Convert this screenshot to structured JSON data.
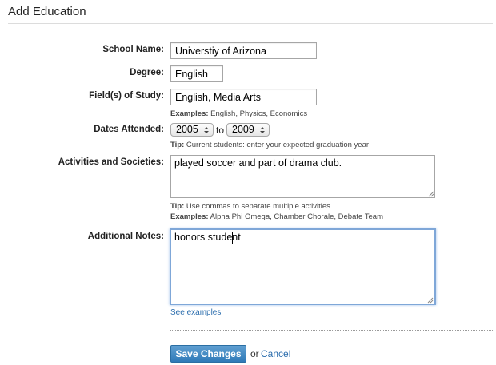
{
  "page": {
    "title": "Add Education"
  },
  "form": {
    "school_name": {
      "label": "School Name:",
      "value": "Universtiy of Arizona"
    },
    "degree": {
      "label": "Degree:",
      "value": "English"
    },
    "field_of_study": {
      "label": "Field(s) of Study:",
      "value": "English, Media Arts",
      "examples_label": "Examples:",
      "examples_text": "English, Physics, Economics"
    },
    "dates_attended": {
      "label": "Dates Attended:",
      "start_year": "2005",
      "to_label": "to",
      "end_year": "2009",
      "tip_label": "Tip:",
      "tip_text": "Current students: enter your expected graduation year"
    },
    "activities": {
      "label": "Activities and Societies:",
      "value": "played soccer and part of drama club.",
      "tip_label": "Tip:",
      "tip_text": "Use commas to separate multiple activities",
      "examples_label": "Examples:",
      "examples_text": "Alpha Phi Omega, Chamber Chorale, Debate Team"
    },
    "notes": {
      "label": "Additional Notes:",
      "value": "honors student",
      "see_examples": "See examples"
    }
  },
  "actions": {
    "save_label": "Save Changes",
    "or_text": "or",
    "cancel_label": "Cancel"
  },
  "colors": {
    "link": "#2b6dad",
    "button": "#2f7ab8",
    "focus_ring": "#7fa7d8"
  }
}
